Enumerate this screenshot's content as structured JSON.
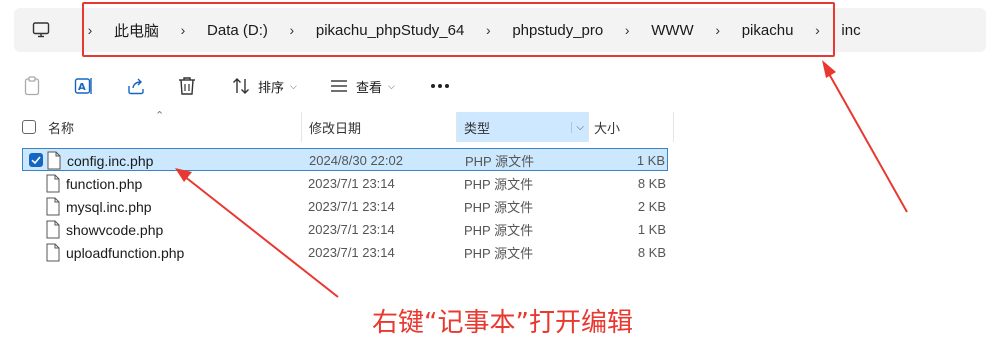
{
  "breadcrumb": {
    "items": [
      "此电脑",
      "Data (D:)",
      "pikachu_phpStudy_64",
      "phpstudy_pro",
      "WWW",
      "pikachu",
      "inc"
    ]
  },
  "toolbar": {
    "sort_label": "排序",
    "view_label": "查看"
  },
  "columns": {
    "name": "名称",
    "modified": "修改日期",
    "type": "类型",
    "size": "大小"
  },
  "files": [
    {
      "name": "config.inc.php",
      "modified": "2024/8/30 22:02",
      "type": "PHP 源文件",
      "size": "1 KB",
      "selected": true
    },
    {
      "name": "function.php",
      "modified": "2023/7/1 23:14",
      "type": "PHP 源文件",
      "size": "8 KB",
      "selected": false
    },
    {
      "name": "mysql.inc.php",
      "modified": "2023/7/1 23:14",
      "type": "PHP 源文件",
      "size": "2 KB",
      "selected": false
    },
    {
      "name": "showvcode.php",
      "modified": "2023/7/1 23:14",
      "type": "PHP 源文件",
      "size": "1 KB",
      "selected": false
    },
    {
      "name": "uploadfunction.php",
      "modified": "2023/7/1 23:14",
      "type": "PHP 源文件",
      "size": "8 KB",
      "selected": false
    }
  ],
  "annotation": {
    "text": "右键“记事本”打开编辑",
    "color": "#e8382f"
  },
  "colors": {
    "selection": "#cce8ff",
    "selection_border": "#3b83c9",
    "checkbox": "#1566c2",
    "sorted_column": "#cde8ff"
  }
}
